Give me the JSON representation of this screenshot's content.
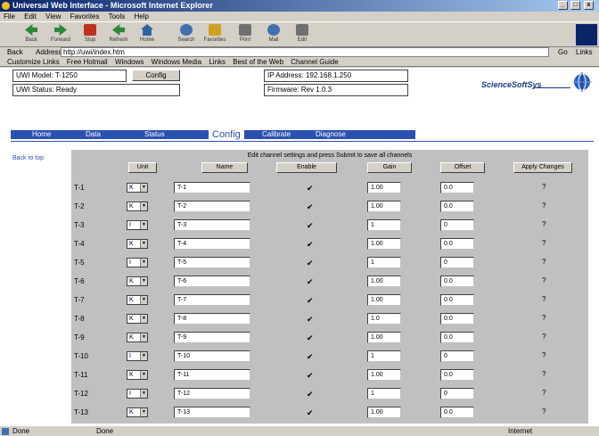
{
  "window": {
    "title": "Universal Web Interface - Microsoft Internet Explorer",
    "minimize": "_",
    "maximize": "□",
    "close": "x"
  },
  "menu": [
    "File",
    "Edit",
    "View",
    "Favorites",
    "Tools",
    "Help"
  ],
  "toolbar": [
    {
      "label": "Back",
      "icon": "back-icon"
    },
    {
      "label": "Forward",
      "icon": "forward-icon"
    },
    {
      "label": "Stop",
      "icon": "stop-icon"
    },
    {
      "label": "Refresh",
      "icon": "refresh-icon"
    },
    {
      "label": "Home",
      "icon": "home-icon"
    },
    {
      "label": "Search",
      "icon": "search-icon"
    },
    {
      "label": "Favorites",
      "icon": "favorites-icon"
    },
    {
      "label": "Print",
      "icon": "print-icon"
    },
    {
      "label": "Mail",
      "icon": "mail-icon"
    },
    {
      "label": "Edit",
      "icon": "edit-icon"
    }
  ],
  "address": {
    "back": "Back",
    "label": "Address",
    "value": "http://uwi/index.htm",
    "go": "Go",
    "links": "Links"
  },
  "links": [
    "Customize Links",
    "Free Hotmail",
    "Windows",
    "Windows Media",
    "Links",
    "Best of the Web",
    "Channel Guide"
  ],
  "header": {
    "box1": "UWI Model: T-1250",
    "box2": "UWI Status: Ready",
    "config_button": "Config",
    "box3": "IP Address: 192.168.1.250",
    "box4": "Firmware: Rev 1.0.3",
    "brand": "ScienceSoftSys"
  },
  "nav": {
    "items": [
      "Home",
      "Data",
      "Status"
    ],
    "active": "Config",
    "extra": [
      "Calibrate",
      "Diagnose"
    ]
  },
  "side_link": "Back to top",
  "grid": {
    "note": "Edit channel settings and press Submit to save all channels",
    "headers": [
      "Unit",
      "Name",
      "Enable",
      "Gain",
      "Offset",
      "Apply Changes"
    ],
    "rows": [
      {
        "label": "T-1",
        "unit": "K",
        "name": "T-1",
        "enabled": "✔",
        "gain": "1.00",
        "offset": "0.0",
        "help": "?"
      },
      {
        "label": "T-2",
        "unit": "K",
        "name": "T-2",
        "enabled": "✔",
        "gain": "1.00",
        "offset": "0.0",
        "help": "?"
      },
      {
        "label": "T-3",
        "unit": "I",
        "name": "T-3",
        "enabled": "✔",
        "gain": "1",
        "offset": "0",
        "help": "?"
      },
      {
        "label": "T-4",
        "unit": "K",
        "name": "T-4",
        "enabled": "✔",
        "gain": "1.00",
        "offset": "0.0",
        "help": "?"
      },
      {
        "label": "T-5",
        "unit": "I",
        "name": "T-5",
        "enabled": "✔",
        "gain": "1",
        "offset": "0",
        "help": "?"
      },
      {
        "label": "T-6",
        "unit": "K",
        "name": "T-6",
        "enabled": "✔",
        "gain": "1.00",
        "offset": "0.0",
        "help": "?"
      },
      {
        "label": "T-7",
        "unit": "K",
        "name": "T-7",
        "enabled": "✔",
        "gain": "1.00",
        "offset": "0.0",
        "help": "?"
      },
      {
        "label": "T-8",
        "unit": "K",
        "name": "T-8",
        "enabled": "✔",
        "gain": "1.0",
        "offset": "0.0",
        "help": "?"
      },
      {
        "label": "T-9",
        "unit": "K",
        "name": "T-9",
        "enabled": "✔",
        "gain": "1.00",
        "offset": "0.0",
        "help": "?"
      },
      {
        "label": "T-10",
        "unit": "I",
        "name": "T-10",
        "enabled": "✔",
        "gain": "1",
        "offset": "0",
        "help": "?"
      },
      {
        "label": "T-11",
        "unit": "K",
        "name": "T-11",
        "enabled": "✔",
        "gain": "1.00",
        "offset": "0.0",
        "help": "?"
      },
      {
        "label": "T-12",
        "unit": "I",
        "name": "T-12",
        "enabled": "✔",
        "gain": "1",
        "offset": "0",
        "help": "?"
      },
      {
        "label": "T-13",
        "unit": "K",
        "name": "T-13",
        "enabled": "✔",
        "gain": "1.00",
        "offset": "0.0",
        "help": "?"
      }
    ]
  },
  "status": {
    "left": "Done",
    "middle": "Done",
    "right": "Internet"
  }
}
